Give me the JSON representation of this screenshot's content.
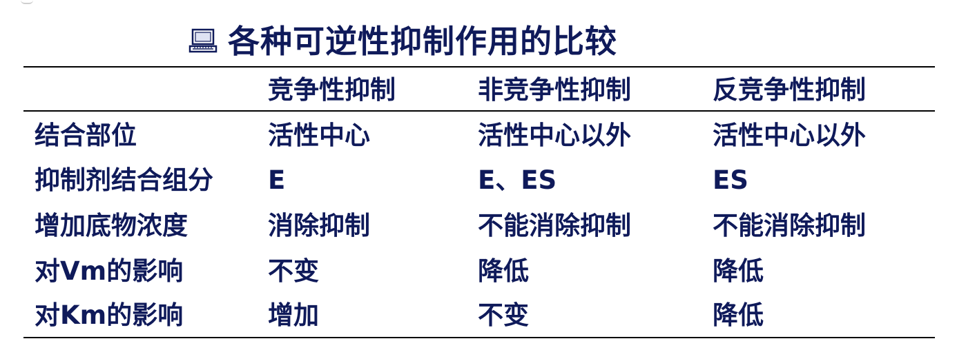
{
  "title": "各种可逆性抑制作用的比较",
  "icon": "laptop-icon",
  "colors": {
    "text": "#0f1a5a",
    "rule": "#000000",
    "background": "#ffffff"
  },
  "table": {
    "headers": [
      "",
      "竞争性抑制",
      "非竞争性抑制",
      "反竞争性抑制"
    ],
    "rows": [
      [
        "结合部位",
        "活性中心",
        "活性中心以外",
        "活性中心以外"
      ],
      [
        "抑制剂结合组分",
        "E",
        "E、ES",
        "ES"
      ],
      [
        "增加底物浓度",
        "消除抑制",
        "不能消除抑制",
        "不能消除抑制"
      ],
      [
        "对Vm的影响",
        "不变",
        "降低",
        "降低"
      ],
      [
        "对Km的影响",
        "增加",
        "不变",
        "降低"
      ]
    ]
  }
}
